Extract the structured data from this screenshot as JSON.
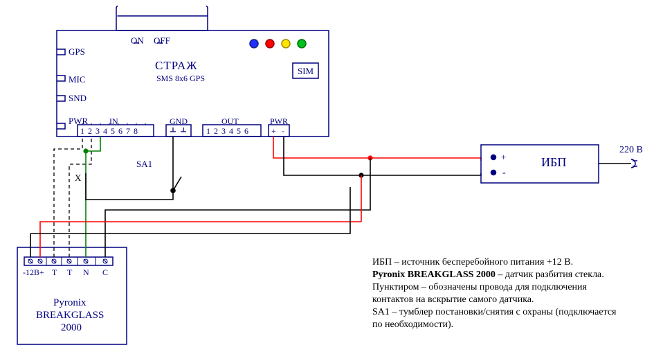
{
  "main_device": {
    "title": "СТРАЖ",
    "subtitle": "SMS 8x6 GPS",
    "sim_label": "SIM",
    "port_gps": "GPS",
    "port_mic": "MIC",
    "port_snd": "SND",
    "port_pwr": "PWR",
    "switch_on": "ON",
    "switch_off": "OFF",
    "led_colors": [
      "#2030ff",
      "#ff0000",
      "#ffe600",
      "#00c020"
    ],
    "terminals": {
      "in_label": "IN",
      "in_pins": [
        "1",
        "2",
        "3",
        "4",
        "5",
        "6",
        "7",
        "8"
      ],
      "gnd_label": "GND",
      "out_label": "OUT",
      "out_pins": [
        "1",
        "2",
        "3",
        "4",
        "5",
        "6"
      ],
      "pwr_label": "PWR",
      "pwr_pins": [
        "+",
        "-"
      ]
    }
  },
  "switch": {
    "label": "SA1"
  },
  "sensor": {
    "line1": "Pyronix",
    "line2": "BREAKGLASS",
    "line3": "2000",
    "terminals": [
      "-12B+",
      "T",
      "T",
      "N",
      "C"
    ],
    "x_label": "X"
  },
  "ups": {
    "title": "ИБП",
    "plus": "+",
    "minus": "-",
    "mains": "220 В"
  },
  "notes": {
    "l1a": "ИБП – источник бесперебойного питания +12 В.",
    "l2b": "Pyronix BREAKGLASS 2000",
    "l2c": " – датчик разбития стекла.",
    "l3": "Пунктиром – обозначены провода для подключения",
    "l4": "контактов на вскрытие самого датчика.",
    "l5": "SA1 – тумблер постановки/снятия с охраны (подключается",
    "l6": "по необходимости)."
  }
}
